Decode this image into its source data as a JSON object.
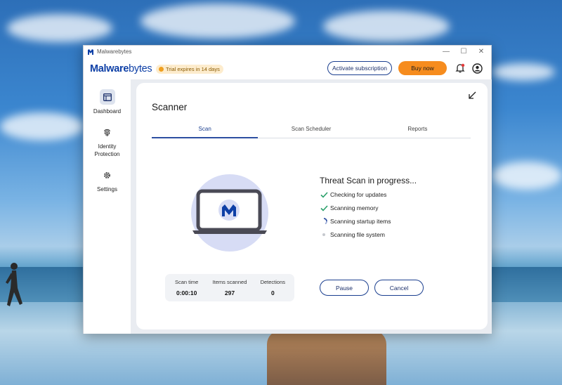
{
  "window": {
    "app_name": "Malwarebytes",
    "minimize_glyph": "—",
    "maximize_glyph": "☐",
    "close_glyph": "✕"
  },
  "header": {
    "logo_bold": "Malware",
    "logo_thin": "bytes",
    "trial_text": "Trial expires in 14 days",
    "activate_label": "Activate subscription",
    "buy_label": "Buy now",
    "icons": [
      "bell-icon",
      "account-icon"
    ]
  },
  "sidebar": {
    "items": [
      {
        "label": "Dashboard",
        "icon": "dashboard-icon",
        "active": true
      },
      {
        "label": "Identity\nProtection",
        "icon": "fingerprint-icon",
        "active": false
      },
      {
        "label": "Settings",
        "icon": "gear-icon",
        "active": false
      }
    ]
  },
  "scanner": {
    "title": "Scanner",
    "tabs": [
      {
        "label": "Scan",
        "active": true
      },
      {
        "label": "Scan Scheduler",
        "active": false
      },
      {
        "label": "Reports",
        "active": false
      }
    ],
    "status_title": "Threat Scan in progress...",
    "steps": [
      {
        "label": "Checking for updates",
        "state": "done"
      },
      {
        "label": "Scanning memory",
        "state": "done"
      },
      {
        "label": "Scanning startup items",
        "state": "in-progress"
      },
      {
        "label": "Scanning file system",
        "state": "pending"
      }
    ],
    "stats": {
      "scan_time_label": "Scan time",
      "scan_time_value": "0:00:10",
      "items_label": "Items scanned",
      "items_value": "297",
      "detections_label": "Detections",
      "detections_value": "0"
    },
    "pause_label": "Pause",
    "cancel_label": "Cancel"
  },
  "colors": {
    "brand_blue": "#0d3fa6",
    "accent_orange": "#f68c1e",
    "check_green": "#2aa06a",
    "illustration_circle": "#d7dcf5"
  }
}
